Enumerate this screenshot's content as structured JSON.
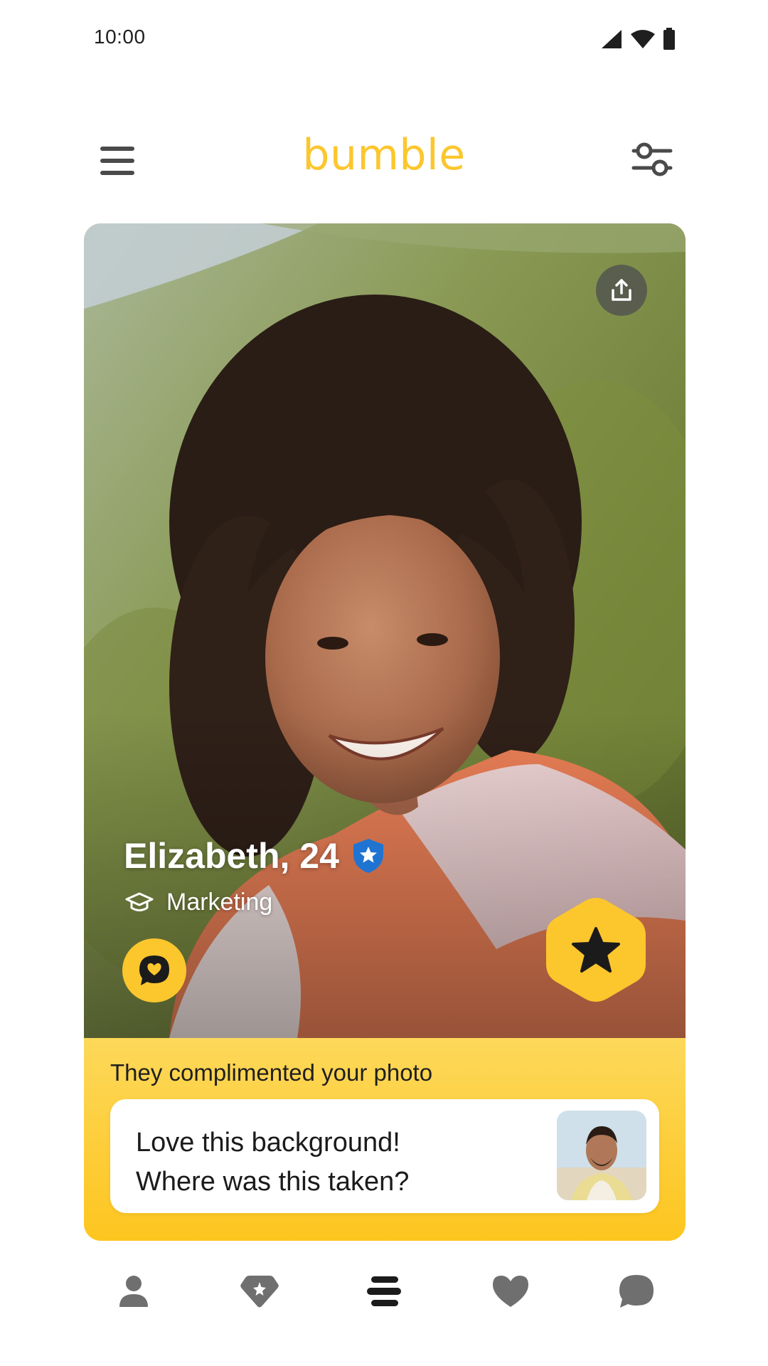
{
  "status_bar": {
    "time": "10:00",
    "icons": [
      "signal-icon",
      "wifi-icon",
      "battery-icon"
    ]
  },
  "header": {
    "brand": "bumble",
    "menu_icon": "hamburger-menu-icon",
    "filter_icon": "filter-sliders-icon"
  },
  "profile": {
    "name_age": "Elizabeth, 24",
    "verified_icon": "verified-shield-icon",
    "job_icon": "graduation-cap-icon",
    "job": "Marketing",
    "share_icon": "share-icon",
    "compliment_icon": "compliment-chat-heart-icon",
    "superswipe_icon": "superswipe-star-icon"
  },
  "compliment": {
    "heading": "They complimented your photo",
    "line1": "Love this background!",
    "line2": "Where was this taken?"
  },
  "bottom_nav": {
    "items": [
      "profile-icon",
      "discover-diamond-icon",
      "people-stack-icon",
      "liked-you-heart-icon",
      "chat-bubble-icon"
    ],
    "active": "people-stack-icon"
  },
  "colors": {
    "brand_yellow": "#fcc62d",
    "verified_blue": "#1f74d2",
    "icon_gray": "#4a4a4a",
    "icon_light_gray": "#6f6f6f"
  }
}
